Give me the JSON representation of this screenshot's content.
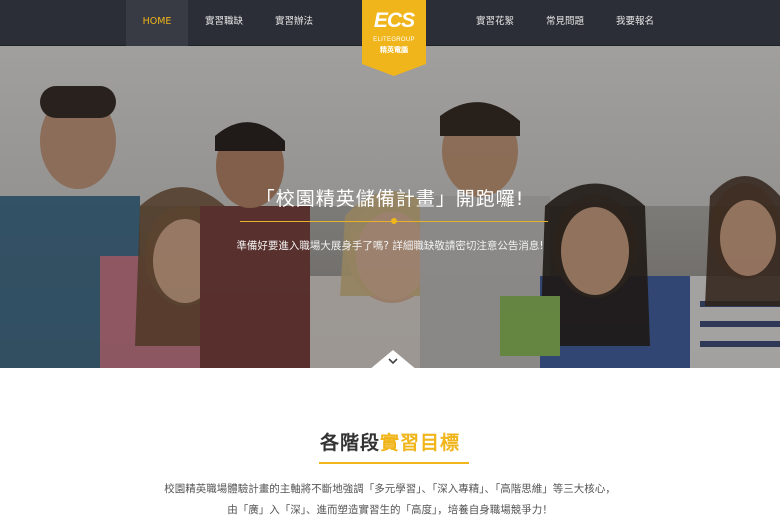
{
  "nav": {
    "left": [
      "HOME",
      "實習職缺",
      "實習辦法"
    ],
    "right": [
      "實習花絮",
      "常見問題",
      "我要報名"
    ],
    "active": "HOME"
  },
  "logo": {
    "mark": "ECS",
    "english": "ELITEGROUP",
    "chinese": "精英電腦",
    "color": "#f0b51a"
  },
  "hero": {
    "title": "「校園精英儲備計畫」開跑囉!",
    "subtitle": "準備好要進入職場大展身手了嗎? 詳細職缺敬請密切注意公告消息!",
    "scroll_icon": "chevron-down-icon"
  },
  "section": {
    "heading_plain": "各階段",
    "heading_accent": "實習目標",
    "line1": "校園精英職場體驗計畫的主軸將不斷地強調「多元學習」、「深入專精」、「高階思維」等三大核心，",
    "line2": "由「廣」入「深」、進而塑造實習生的「高度」，培養自身職場競爭力！"
  },
  "colors": {
    "accent": "#f0b51a",
    "nav_bg": "#2b2e36"
  }
}
